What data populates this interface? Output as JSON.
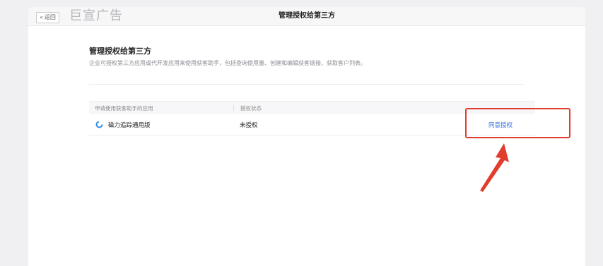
{
  "header": {
    "back_label": "返回",
    "brand": "巨宣广告",
    "title": "管理授权给第三方"
  },
  "section": {
    "title": "管理授权给第三方",
    "description": "企业可授权第三方应用或代开发应用来使用获客助手，包括查询使用量、创建和编辑获客链接、获取客户列表。"
  },
  "table": {
    "columns": [
      "申请使用获客助手的应用",
      "授权状态"
    ],
    "rows": [
      {
        "app": "磁力追踪通用版",
        "status": "未授权",
        "action": "同意授权",
        "icon": "app-logo-icon"
      }
    ]
  },
  "colors": {
    "accent": "#2f6fe0",
    "highlight": "#e23c2e"
  }
}
